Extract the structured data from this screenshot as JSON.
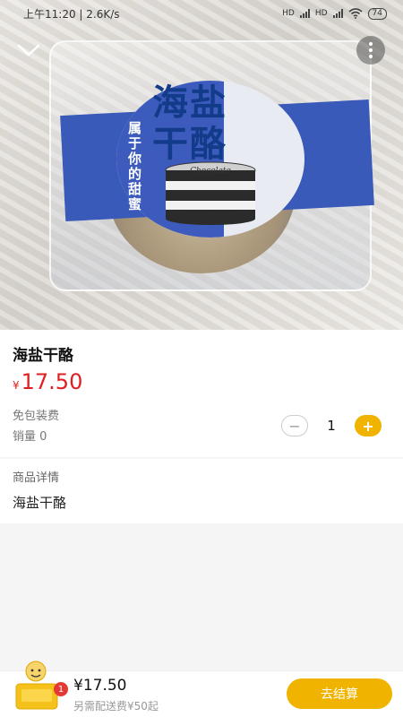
{
  "status_bar": {
    "time_speed": "上午11:20 | 2.6K/s",
    "network_labels": [
      "HD",
      "HD"
    ],
    "battery": "74"
  },
  "hero_image": {
    "packaging_title": "海盐干酪",
    "packaging_subtitle": "属于你的甜蜜",
    "cake_script": "Chocolate"
  },
  "product": {
    "name": "海盐干酪",
    "currency_symbol": "¥",
    "price": "17.50",
    "shipping": "免包装费",
    "sales": "销量 0",
    "quantity": "1",
    "minus_label": "−",
    "plus_label": "+"
  },
  "details": {
    "title": "商品详情",
    "body": "海盐干酪"
  },
  "cart": {
    "badge": "1",
    "total": "¥17.50",
    "delivery_note": "另需配送费¥50起",
    "checkout_label": "去结算"
  },
  "colors": {
    "accent": "#f0b400",
    "price": "#e02020",
    "badge": "#e53935"
  }
}
